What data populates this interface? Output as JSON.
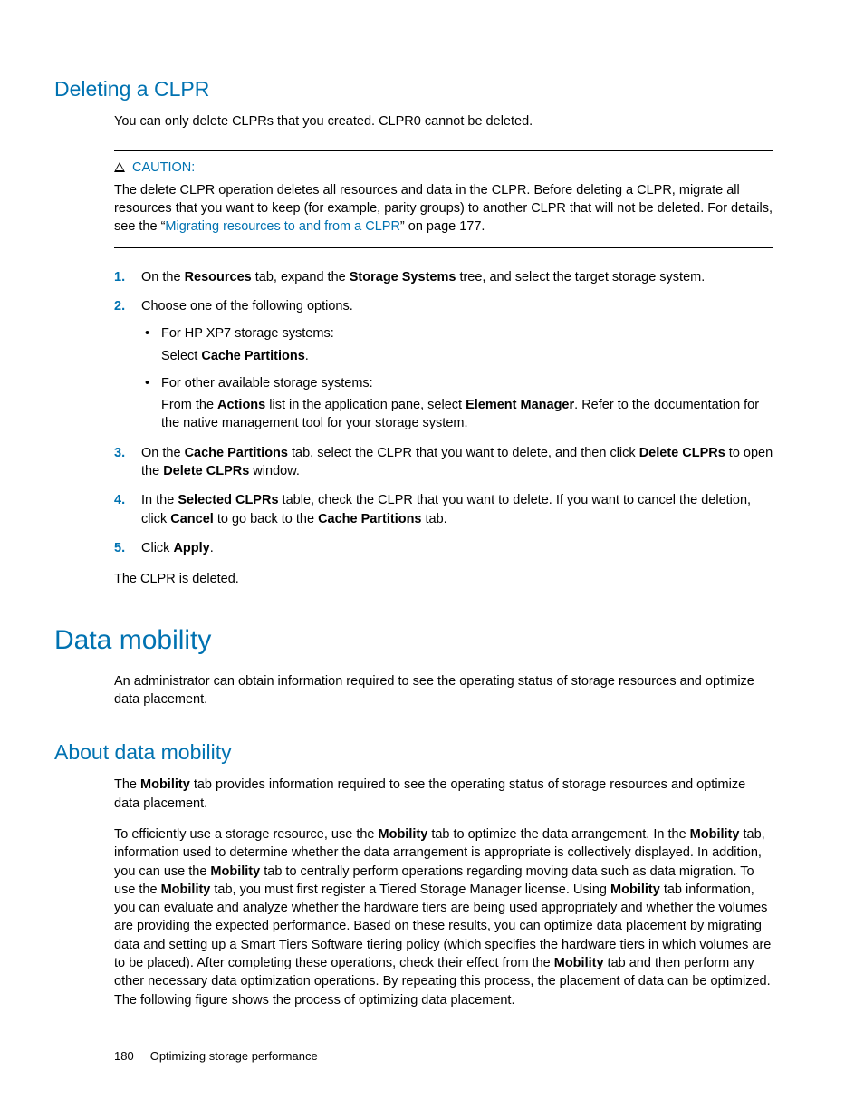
{
  "section1": {
    "title": "Deleting a CLPR",
    "intro": "You can only delete CLPRs that you created. CLPR0 cannot be deleted.",
    "caution": {
      "label": "CAUTION:",
      "text_before_link": "The delete CLPR operation deletes all resources and data in the CLPR. Before deleting a CLPR, migrate all resources that you want to keep (for example, parity groups) to another CLPR that will not be deleted. For details, see the “",
      "link_text": "Migrating resources to and from a CLPR",
      "text_after_link": "” on page 177."
    },
    "steps": [
      {
        "pre": "On the ",
        "b1": "Resources",
        "mid1": " tab, expand the ",
        "b2": "Storage Systems",
        "post": " tree, and select the target storage system."
      },
      {
        "intro": "Choose one of the following options.",
        "bullets": [
          {
            "line1": "For HP XP7 storage systems:",
            "line2_pre": "Select ",
            "line2_b": "Cache Partitions",
            "line2_post": "."
          },
          {
            "line1": "For other available storage systems:",
            "line2_pre": "From the ",
            "line2_b1": "Actions",
            "line2_mid": " list in the application pane, select ",
            "line2_b2": "Element Manager",
            "line2_post": ". Refer to the documentation for the native management tool for your storage system."
          }
        ]
      },
      {
        "pre": "On the ",
        "b1": "Cache Partitions",
        "mid1": " tab, select the CLPR that you want to delete, and then click ",
        "b2": "Delete CLPRs",
        "mid2": " to open the ",
        "b3": "Delete CLPRs",
        "post": " window."
      },
      {
        "pre": "In the ",
        "b1": "Selected CLPRs",
        "mid1": " table, check the CLPR that you want to delete. If you want to cancel the deletion, click ",
        "b2": "Cancel",
        "mid2": " to go back to the ",
        "b3": "Cache Partitions",
        "post": " tab."
      },
      {
        "pre": "Click ",
        "b1": "Apply",
        "post": "."
      }
    ],
    "result": "The CLPR is deleted."
  },
  "section2": {
    "title": "Data mobility",
    "intro": "An administrator can obtain information required to see the operating status of storage resources and optimize data placement.",
    "sub_title": "About data mobility",
    "p1_pre": "The ",
    "p1_b": "Mobility",
    "p1_post": " tab provides information required to see the operating status of storage resources and optimize data placement.",
    "p2_pre": "To efficiently use a storage resource, use the ",
    "p2_b1": "Mobility",
    "p2_m1": " tab to optimize the data arrangement. In the ",
    "p2_b2": "Mobility",
    "p2_m2": " tab, information used to determine whether the data arrangement is appropriate is collectively displayed. In addition, you can use the ",
    "p2_b3": "Mobility",
    "p2_m3": " tab to centrally perform operations regarding moving data such as data migration. To use the ",
    "p2_b4": "Mobility",
    "p2_m4": " tab, you must first register a Tiered Storage Manager license. Using ",
    "p2_b5": "Mobility",
    "p2_m5": " tab information, you can evaluate and analyze whether the hardware tiers are being used appropriately and whether the volumes are providing the expected performance. Based on these results, you can optimize data placement by migrating data and setting up a Smart Tiers Software tiering policy (which specifies the hardware tiers in which volumes are to be placed). After completing these operations, check their effect from the ",
    "p2_b6": "Mobility",
    "p2_m6": " tab and then perform any other necessary data optimization operations. By repeating this process, the placement of data can be optimized. The following figure shows the process of optimizing data placement."
  },
  "footer": {
    "page_num": "180",
    "chapter": "Optimizing storage performance"
  }
}
